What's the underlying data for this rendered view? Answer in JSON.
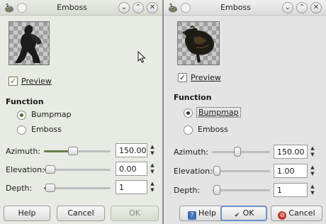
{
  "left_dialog": {
    "title": "Emboss",
    "preview_label": "Preview",
    "preview_checked": "✓",
    "function_heading": "Function",
    "options": [
      "Bumpmap",
      "Emboss"
    ],
    "params": [
      {
        "label": "Azimuth:",
        "value": "150.00",
        "level": 0.42
      },
      {
        "label": "Elevation:",
        "value": "0.00",
        "level": 0.0
      },
      {
        "label": "Depth:",
        "value": "1",
        "level": 0.0
      }
    ],
    "buttons": {
      "help": "Help",
      "cancel": "Cancel",
      "ok": "OK"
    }
  },
  "right_dialog": {
    "title": "Emboss",
    "preview_label": "Preview",
    "preview_checked": "✓",
    "function_heading": "Function",
    "options": [
      "Bumpmap",
      "Emboss"
    ],
    "params": [
      {
        "label": "Azimuth:",
        "value": "150.00",
        "level": 0.42
      },
      {
        "label": "Elevation:",
        "value": "1.00",
        "level": 0.0
      },
      {
        "label": "Depth:",
        "value": "1",
        "level": 0.0
      }
    ],
    "buttons": {
      "help": "Help",
      "ok": "OK",
      "cancel": "Cancel"
    }
  },
  "icons": {
    "app": "gimp-wilber-icon",
    "pin": "pin-icon",
    "minimize": "chevron-down-icon",
    "maximize": "chevron-up-icon",
    "close": "close-icon",
    "cursor": "mouse-pointer-icon"
  },
  "colors": {
    "left_accent": "#66804a",
    "right_focus": "#6b8fc8",
    "cancel_icon": "#c0392b",
    "help_icon": "#3d6fb6"
  }
}
